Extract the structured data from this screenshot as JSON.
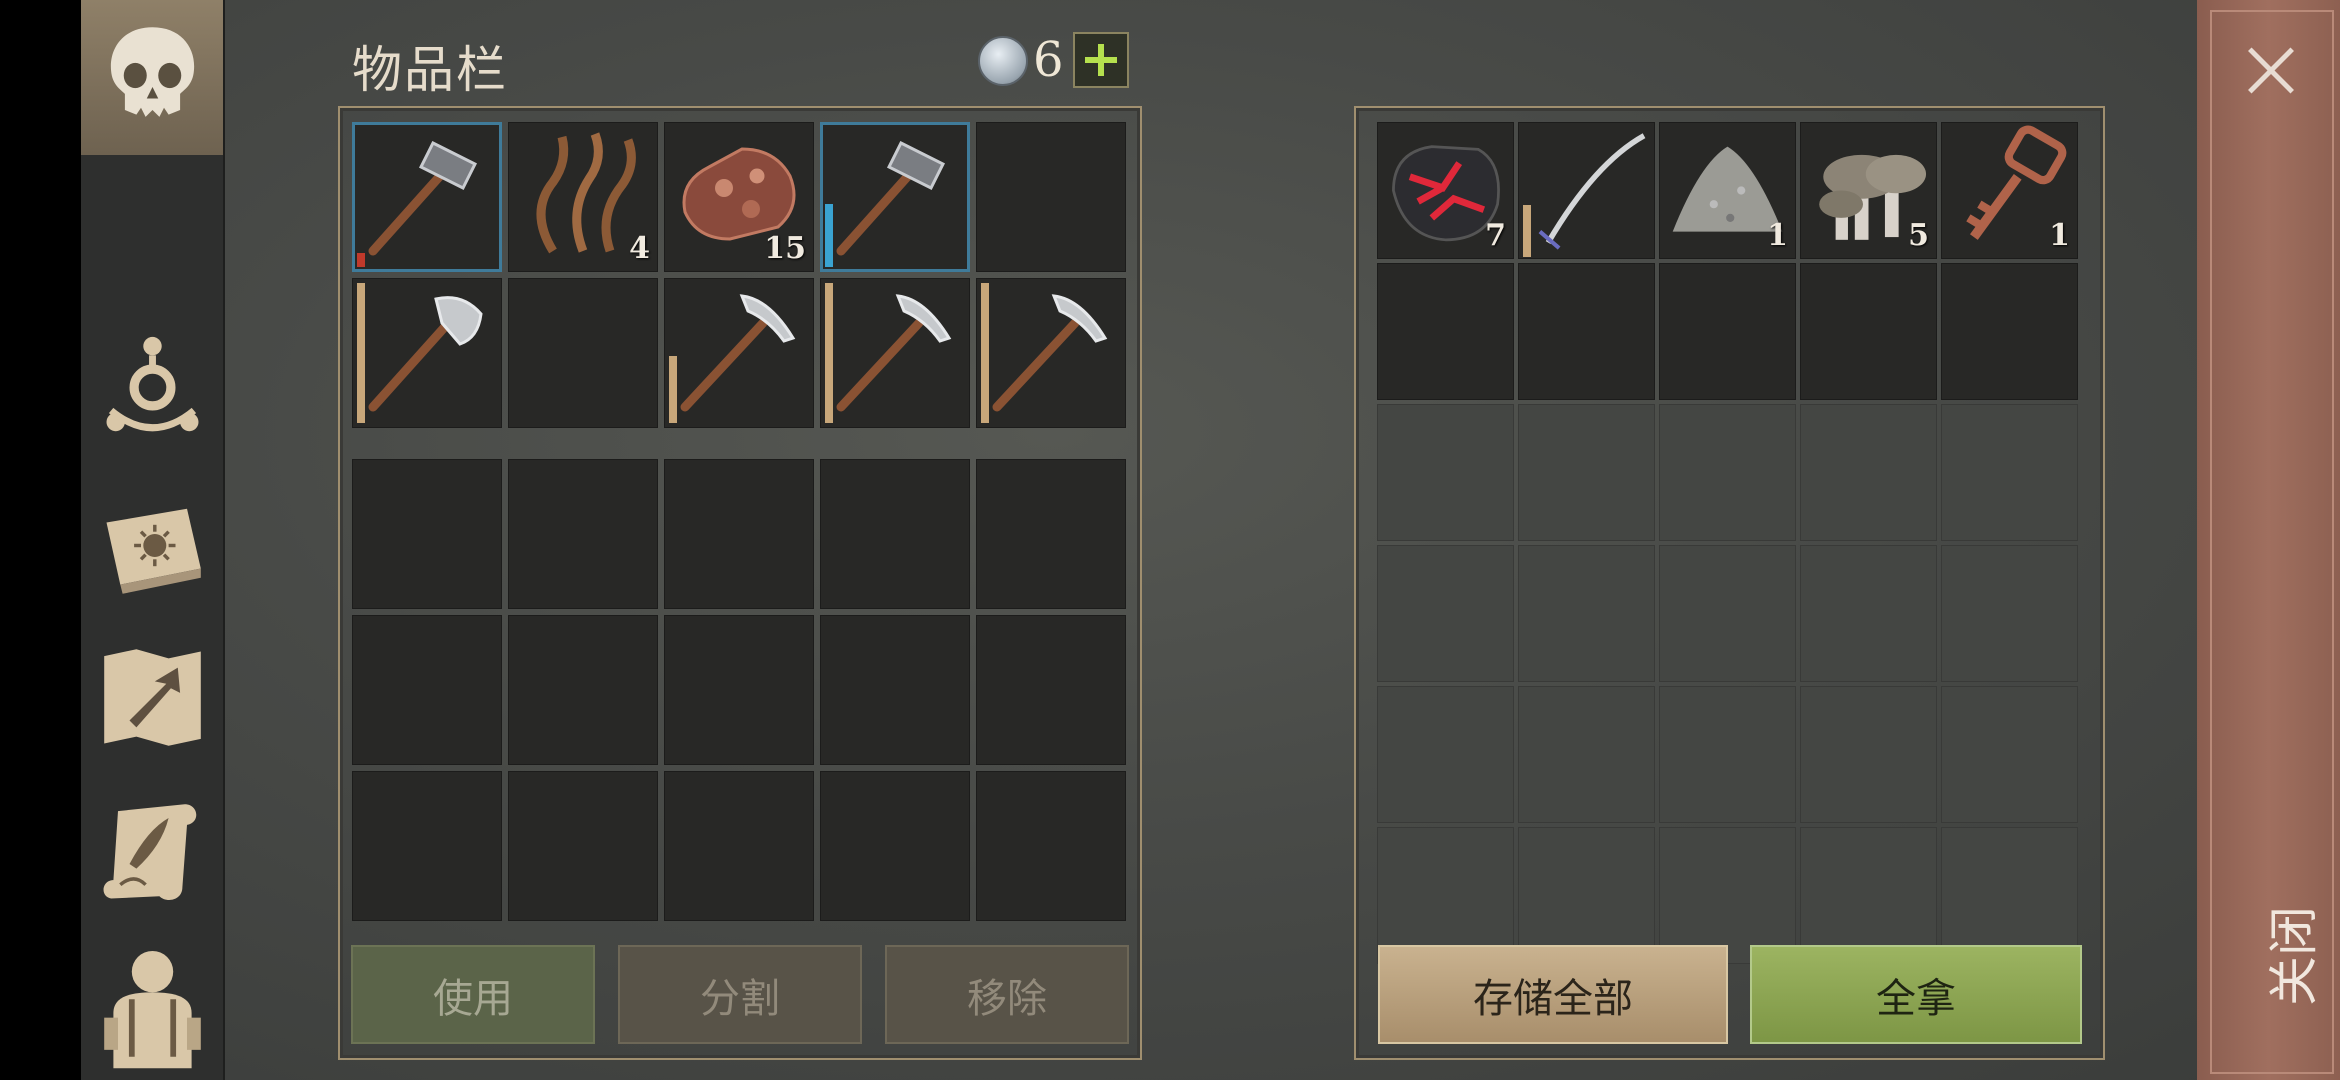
{
  "inventory": {
    "title": "物品栏",
    "currency_count": "6",
    "slots_top": [
      {
        "item": "hammer",
        "qty": "",
        "selected": true,
        "durability": 0.1,
        "dur_color": "#c0392b"
      },
      {
        "item": "fiber",
        "qty": "4"
      },
      {
        "item": "copper-ore",
        "qty": "15"
      },
      {
        "item": "hammer",
        "qty": "",
        "selected": true,
        "durability": 0.45,
        "dur_color": "#3aa3d1"
      },
      {
        "item": "",
        "qty": ""
      },
      {
        "item": "hatchet",
        "qty": "",
        "durability": 1.0,
        "dur_color": "#c8a77a"
      },
      {
        "item": "",
        "qty": ""
      },
      {
        "item": "pickaxe",
        "qty": "",
        "durability": 0.48,
        "dur_color": "#c8a77a"
      },
      {
        "item": "pickaxe",
        "qty": "",
        "durability": 1.0,
        "dur_color": "#c8a77a"
      },
      {
        "item": "pickaxe",
        "qty": "",
        "durability": 1.0,
        "dur_color": "#c8a77a"
      }
    ],
    "buttons": {
      "use": "使用",
      "split": "分割",
      "remove": "移除"
    }
  },
  "container": {
    "slots": [
      {
        "item": "red-crystal-ore",
        "qty": "7"
      },
      {
        "item": "katana",
        "qty": "",
        "durability": 0.4,
        "dur_color": "#c8a77a"
      },
      {
        "item": "sand-pile",
        "qty": "1"
      },
      {
        "item": "mushrooms",
        "qty": "5"
      },
      {
        "item": "copper-key",
        "qty": "1"
      }
    ],
    "buttons": {
      "store_all": "存储全部",
      "take_all": "全拿"
    }
  },
  "close": {
    "label": "关闭"
  },
  "colors": {
    "accent_green": "#b5e04e",
    "panel_border": "#a08f6f",
    "close_strip": "#a06f5f"
  }
}
